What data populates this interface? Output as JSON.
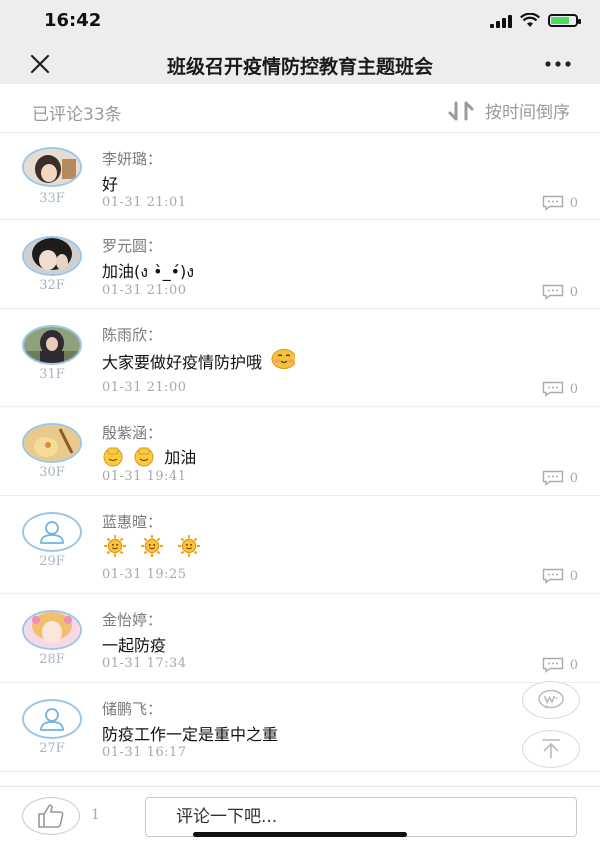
{
  "status": {
    "time": "16:42",
    "battery_level": 0.7
  },
  "nav": {
    "title": "班级召开疫情防控教育主题班会",
    "close_icon": "close-icon",
    "more_icon": "more-dots-icon"
  },
  "header": {
    "count_text": "已评论33条",
    "sort_label": "按时间倒序"
  },
  "comments": [
    {
      "floor": "33F",
      "name": "李妍璐：",
      "text": "好",
      "time": "01-31 21:01",
      "replies": "0",
      "avatar": "photo"
    },
    {
      "floor": "32F",
      "name": "罗元圆：",
      "text": "加油(ง •̀_•́)ง",
      "time": "01-31 21:00",
      "replies": "0",
      "avatar": "photo"
    },
    {
      "floor": "31F",
      "name": "陈雨欣：",
      "text": "大家要做好疫情防护哦",
      "time": "01-31 21:00",
      "replies": "0",
      "avatar": "photo"
    },
    {
      "floor": "30F",
      "name": "殷紫涵：",
      "text": "加油",
      "time": "01-31 19:41",
      "replies": "0",
      "avatar": "photo"
    },
    {
      "floor": "29F",
      "name": "蓝惠暄：",
      "text": "",
      "time": "01-31 19:25",
      "replies": "0",
      "avatar": "default"
    },
    {
      "floor": "28F",
      "name": "金怡婷：",
      "text": "一起防疫",
      "time": "01-31 17:34",
      "replies": "0",
      "avatar": "photo"
    },
    {
      "floor": "27F",
      "name": "储鹏飞：",
      "text": "防疫工作一定是重中之重",
      "time": "01-31 16:17",
      "replies": "",
      "avatar": "default"
    }
  ],
  "bottom": {
    "like_count": "1",
    "input_placeholder": "评论一下吧..."
  },
  "colors": {
    "avatar_border": "#9cc7e8",
    "meta_gray": "#a8a8a8"
  }
}
